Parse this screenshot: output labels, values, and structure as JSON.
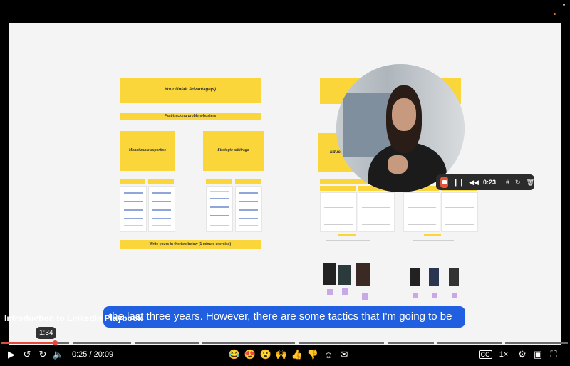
{
  "board": {
    "left_title": "Your Unfair Advantage(s)",
    "left_subtitle": "Fast-tracking problem-busters",
    "left_box1": "Monetizable expertise",
    "left_box2": "Strategic arbitrage",
    "left_footer": "Write yours in the two below (1 minute exercise)",
    "right_box": "Educat"
  },
  "recorder": {
    "time": "0:23"
  },
  "caption": {
    "text": "the last three years. However, there are some tactics that I'm going to be"
  },
  "video": {
    "title": "Introduction to LinkedIn Playbook",
    "hover_time": "1:34",
    "current_time": "0:25",
    "duration": "20:09",
    "time_display": "0:25 / 20:09",
    "speed": "1×",
    "progress": 0.021
  }
}
